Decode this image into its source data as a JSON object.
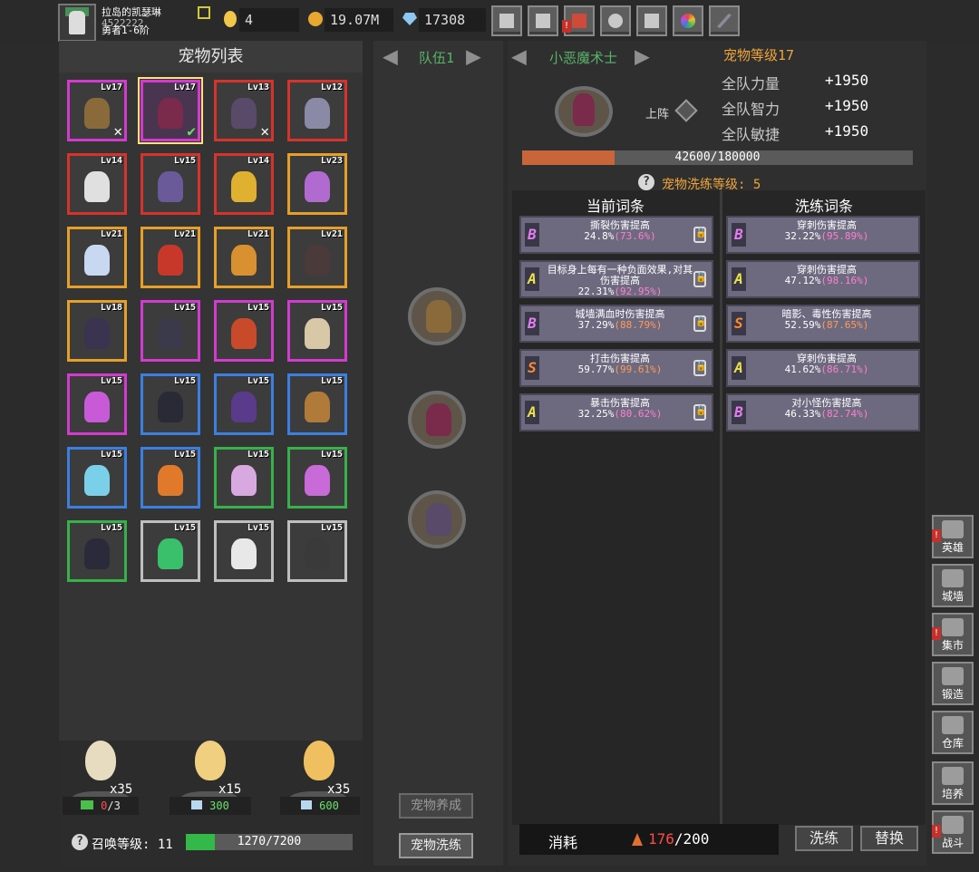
{
  "player": {
    "name": "拉岛的凯瑟琳",
    "id": "4522222",
    "rank": "勇者1-6阶"
  },
  "resources": {
    "eggs": "4",
    "gold": "19.07M",
    "gems": "17308"
  },
  "topbar_icons": [
    "cart-icon",
    "mail-icon",
    "gamepad-icon",
    "gear-icon",
    "gift-icon",
    "wheel-icon",
    "feather-icon"
  ],
  "pet_list": {
    "title": "宠物列表",
    "pets": [
      {
        "level": "Lv17",
        "rarity": "purple",
        "color": "#8a6a3a",
        "mark": "✕",
        "selected": false
      },
      {
        "level": "Lv17",
        "rarity": "purple",
        "color": "#7a2a4a",
        "mark": "✔",
        "selected": true
      },
      {
        "level": "Lv13",
        "rarity": "red",
        "color": "#5a4a6a",
        "mark": "✕",
        "selected": false
      },
      {
        "level": "Lv12",
        "rarity": "red",
        "color": "#8a8aa6",
        "mark": "",
        "selected": false
      },
      {
        "level": "Lv14",
        "rarity": "red",
        "color": "#e0e0e0",
        "mark": "",
        "selected": false
      },
      {
        "level": "Lv15",
        "rarity": "red",
        "color": "#6a5a9a",
        "mark": "",
        "selected": false
      },
      {
        "level": "Lv14",
        "rarity": "red",
        "color": "#e0b030",
        "mark": "",
        "selected": false
      },
      {
        "level": "Lv23",
        "rarity": "orange",
        "color": "#b06ad0",
        "mark": "",
        "selected": false
      },
      {
        "level": "Lv21",
        "rarity": "orange",
        "color": "#c8d8f0",
        "mark": "",
        "selected": false
      },
      {
        "level": "Lv21",
        "rarity": "orange",
        "color": "#c8382a",
        "mark": "",
        "selected": false
      },
      {
        "level": "Lv21",
        "rarity": "orange",
        "color": "#d89030",
        "mark": "",
        "selected": false
      },
      {
        "level": "Lv21",
        "rarity": "orange",
        "color": "#4a3a3a",
        "mark": "",
        "selected": false
      },
      {
        "level": "Lv18",
        "rarity": "orange",
        "color": "#3a3450",
        "mark": "",
        "selected": false
      },
      {
        "level": "Lv15",
        "rarity": "purple",
        "color": "#3a3a4a",
        "mark": "",
        "selected": false
      },
      {
        "level": "Lv15",
        "rarity": "purple",
        "color": "#c84a2a",
        "mark": "",
        "selected": false
      },
      {
        "level": "Lv15",
        "rarity": "purple",
        "color": "#d8c8a8",
        "mark": "",
        "selected": false
      },
      {
        "level": "Lv15",
        "rarity": "purple",
        "color": "#c85ad8",
        "mark": "",
        "selected": false
      },
      {
        "level": "Lv15",
        "rarity": "blue",
        "color": "#2a2a36",
        "mark": "",
        "selected": false
      },
      {
        "level": "Lv15",
        "rarity": "blue",
        "color": "#5a3a8a",
        "mark": "",
        "selected": false
      },
      {
        "level": "Lv15",
        "rarity": "blue",
        "color": "#b07a3a",
        "mark": "",
        "selected": false
      },
      {
        "level": "Lv15",
        "rarity": "blue",
        "color": "#7ad0e8",
        "mark": "",
        "selected": false
      },
      {
        "level": "Lv15",
        "rarity": "blue",
        "color": "#e07a2a",
        "mark": "",
        "selected": false
      },
      {
        "level": "Lv15",
        "rarity": "green",
        "color": "#d8a8e0",
        "mark": "",
        "selected": false
      },
      {
        "level": "Lv15",
        "rarity": "green",
        "color": "#c86ad8",
        "mark": "",
        "selected": false
      },
      {
        "level": "Lv15",
        "rarity": "green",
        "color": "#2a2a3a",
        "mark": "",
        "selected": false
      },
      {
        "level": "Lv15",
        "rarity": "grey",
        "color": "#3ac06a",
        "mark": "",
        "selected": false
      },
      {
        "level": "Lv15",
        "rarity": "grey",
        "color": "#e8e8e8",
        "mark": "",
        "selected": false
      },
      {
        "level": "Lv15",
        "rarity": "grey",
        "color": "#3a3a3a",
        "mark": "",
        "selected": false
      }
    ]
  },
  "eggs": [
    {
      "count": "x35",
      "cost_value": "0",
      "cost_total": "/3",
      "cost_type": "video-icon"
    },
    {
      "count": "x15",
      "cost_value": "300",
      "cost_total": "",
      "cost_type": "diamond-icon"
    },
    {
      "count": "x35",
      "cost_value": "600",
      "cost_total": "",
      "cost_type": "diamond-icon"
    }
  ],
  "summon": {
    "label": "召唤等级:",
    "level": "11",
    "progress_text": "1270/7200",
    "progress": 0.176
  },
  "team": {
    "name": "队伍1",
    "train_btn": "宠物养成",
    "refine_btn": "宠物洗练",
    "pets": [
      {
        "color": "#8a6a3a"
      },
      {
        "color": "#7a2a4a"
      },
      {
        "color": "#5a4a6a"
      }
    ]
  },
  "pet_detail": {
    "name": "小恶魔术士",
    "level_label": "宠物等级17",
    "deploy_label": "上阵",
    "stats": [
      {
        "label": "全队力量",
        "value": "+1950"
      },
      {
        "label": "全队智力",
        "value": "+1950"
      },
      {
        "label": "全队敏捷",
        "value": "+1950"
      }
    ],
    "xp_text": "42600/180000",
    "xp_progress": 0.2367,
    "refine_label": "宠物洗练等级: 5"
  },
  "affix_headers": {
    "current": "当前词条",
    "refine": "洗练词条"
  },
  "current_affixes": [
    {
      "grade": "B",
      "name": "撕裂伤害提高",
      "value": "24.8%",
      "range": "(73.6%)",
      "range_color": "pink"
    },
    {
      "grade": "A",
      "name": "目标身上每有一种负面效果,对其伤害提高",
      "value": "22.31%",
      "range": "(92.95%)",
      "range_color": "pink"
    },
    {
      "grade": "B",
      "name": "城墙满血时伤害提高",
      "value": "37.29%",
      "range": "(88.79%)",
      "range_color": "orange"
    },
    {
      "grade": "S",
      "name": "打击伤害提高",
      "value": "59.77%",
      "range": "(99.61%)",
      "range_color": "orange"
    },
    {
      "grade": "A",
      "name": "暴击伤害提高",
      "value": "32.25%",
      "range": "(80.62%)",
      "range_color": "pink"
    }
  ],
  "refine_affixes": [
    {
      "grade": "B",
      "name": "穿刺伤害提高",
      "value": "32.22%",
      "range": "(95.89%)",
      "range_color": "pink"
    },
    {
      "grade": "A",
      "name": "穿刺伤害提高",
      "value": "47.12%",
      "range": "(98.16%)",
      "range_color": "pink"
    },
    {
      "grade": "S",
      "name": "暗影、毒性伤害提高",
      "value": "52.59%",
      "range": "(87.65%)",
      "range_color": "orange"
    },
    {
      "grade": "A",
      "name": "穿刺伤害提高",
      "value": "41.62%",
      "range": "(86.71%)",
      "range_color": "pink"
    },
    {
      "grade": "B",
      "name": "对小怪伤害提高",
      "value": "46.33%",
      "range": "(82.74%)",
      "range_color": "pink"
    }
  ],
  "cost": {
    "label": "消耗",
    "current": "176",
    "total": "/200"
  },
  "actions": {
    "refine": "洗练",
    "replace": "替换"
  },
  "side_nav": [
    {
      "label": "英雄",
      "badge": true,
      "icon": "helmet-icon"
    },
    {
      "label": "城墙",
      "badge": false,
      "icon": "wall-icon"
    },
    {
      "label": "集市",
      "badge": true,
      "icon": "market-icon"
    },
    {
      "label": "锻造",
      "badge": false,
      "icon": "anvil-icon"
    },
    {
      "label": "仓库",
      "badge": false,
      "icon": "chest-icon"
    },
    {
      "label": "培养",
      "badge": false,
      "icon": "fountain-icon"
    },
    {
      "label": "战斗",
      "badge": true,
      "icon": "portal-icon"
    }
  ]
}
